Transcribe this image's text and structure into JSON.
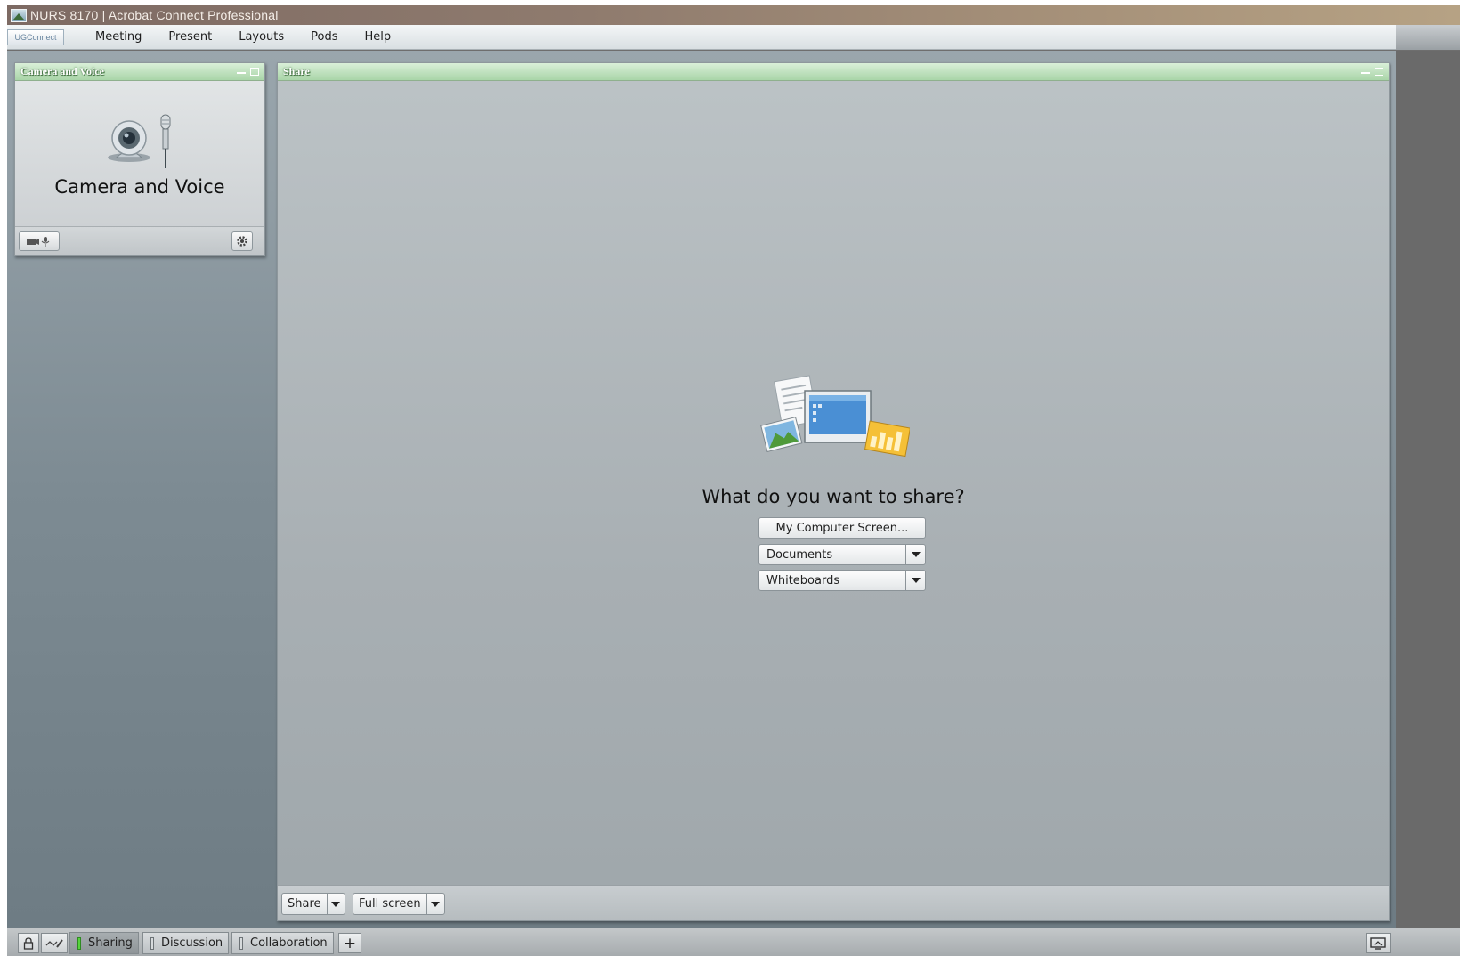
{
  "window": {
    "title": "NURS 8170 | Acrobat Connect Professional",
    "brand": "UGConnect"
  },
  "menu": {
    "items": [
      "Meeting",
      "Present",
      "Layouts",
      "Pods",
      "Help"
    ]
  },
  "camera_pod": {
    "title": "Camera and Voice",
    "body_label": "Camera and Voice"
  },
  "share_pod": {
    "title": "Share",
    "question": "What do you want to share?",
    "options": {
      "computer_screen": "My Computer Screen...",
      "documents": "Documents",
      "whiteboards": "Whiteboards"
    },
    "footer": {
      "share_label": "Share",
      "fullscreen_label": "Full screen"
    }
  },
  "bottom_tabs": {
    "tabs": [
      {
        "label": "Sharing",
        "active": true
      },
      {
        "label": "Discussion",
        "active": false
      },
      {
        "label": "Collaboration",
        "active": false
      }
    ],
    "add_label": "+"
  },
  "colors": {
    "pod_header": "#a9d5a8",
    "active_tab_marker": "#56d33c",
    "workspace": "#7d8b93"
  }
}
